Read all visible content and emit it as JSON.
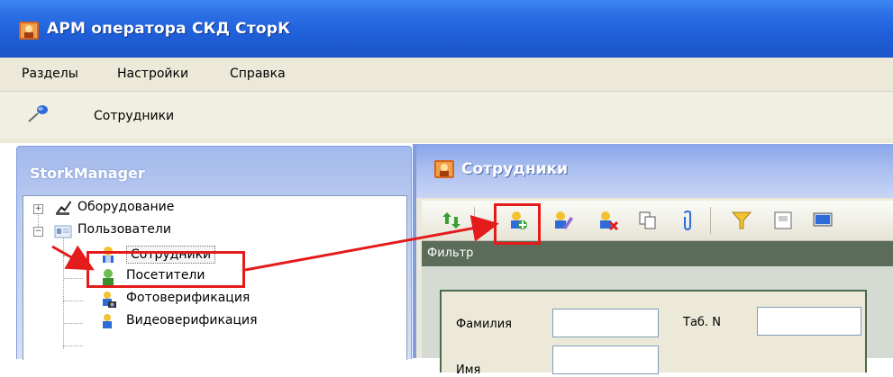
{
  "window": {
    "title": "АРМ оператора СКД СторК"
  },
  "menu": {
    "items": [
      "Разделы",
      "Настройки",
      "Справка"
    ]
  },
  "toolbar": {
    "label": "Сотрудники"
  },
  "left_panel": {
    "title": "StorkManager",
    "tree": [
      {
        "label": "Оборудование"
      },
      {
        "label": "Пользователи"
      },
      {
        "label": "Сотрудники"
      },
      {
        "label": "Посетители"
      },
      {
        "label": "Фотоверификация"
      },
      {
        "label": "Видеоверификация"
      }
    ]
  },
  "right_panel": {
    "title": "Сотрудники",
    "toolbar_icons": [
      "refresh-icon",
      "add-user-icon",
      "edit-user-icon",
      "delete-user-icon",
      "copy-icon",
      "attach-icon",
      "filter-icon",
      "card-icon",
      "monitor-icon"
    ],
    "filter_label": "Фильтр",
    "fields": {
      "surname_label": "Фамилия",
      "surname_value": "",
      "tab_label": "Таб. N",
      "tab_value": "",
      "name_label": "Имя",
      "name_value": ""
    }
  },
  "colors": {
    "title_bar": "#2b6fe7",
    "highlight": "#e41b1b",
    "panel_header": "#a5bbef"
  }
}
